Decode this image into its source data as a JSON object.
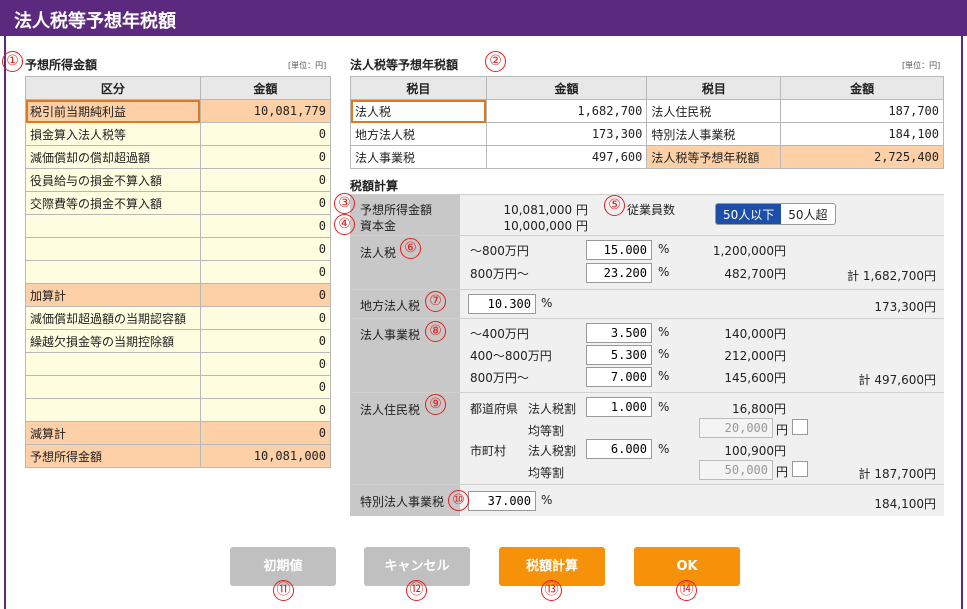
{
  "window": {
    "title": "法人税等予想年税額"
  },
  "markers": [
    "①",
    "②",
    "③",
    "④",
    "⑤",
    "⑥",
    "⑦",
    "⑧",
    "⑨",
    "⑩",
    "⑪",
    "⑫",
    "⑬",
    "⑭"
  ],
  "income": {
    "title": "予想所得金額",
    "unit": "[単位：円]",
    "headers": [
      "区分",
      "金額"
    ],
    "rows": [
      {
        "label": "税引前当期純利益",
        "value": "10,081,779"
      },
      {
        "label": "損金算入法人税等",
        "value": "0"
      },
      {
        "label": "減価償却の償却超過額",
        "value": "0"
      },
      {
        "label": "役員給与の損金不算入額",
        "value": "0"
      },
      {
        "label": "交際費等の損金不算入額",
        "value": "0"
      },
      {
        "label": "",
        "value": "0"
      },
      {
        "label": "",
        "value": "0"
      },
      {
        "label": "",
        "value": "0"
      },
      {
        "label": "加算計",
        "value": "0"
      },
      {
        "label": "減価償却超過額の当期認容額",
        "value": "0"
      },
      {
        "label": "繰越欠損金等の当期控除額",
        "value": "0"
      },
      {
        "label": "",
        "value": "0"
      },
      {
        "label": "",
        "value": "0"
      },
      {
        "label": "",
        "value": "0"
      },
      {
        "label": "減算計",
        "value": "0"
      },
      {
        "label": "予想所得金額",
        "value": "10,081,000"
      }
    ]
  },
  "annual": {
    "title": "法人税等予想年税額",
    "unit": "[単位：円]",
    "headers": [
      "税目",
      "金額",
      "税目",
      "金額"
    ],
    "rows": [
      [
        "法人税",
        "1,682,700",
        "法人住民税",
        "187,700"
      ],
      [
        "地方法人税",
        "173,300",
        "特別法人事業税",
        "184,100"
      ],
      [
        "法人事業税",
        "497,600",
        "法人税等予想年税額",
        "2,725,400"
      ]
    ]
  },
  "calc": {
    "title": "税額計算",
    "income_label": "予想所得金額",
    "income_value": "10,081,000 円",
    "capital_label": "資本金",
    "capital_value": "10,000,000 円",
    "employees_label": "従業員数",
    "employees_options": [
      "50人以下",
      "50人超"
    ],
    "percent": "%",
    "yen": "円",
    "corp_tax": {
      "label": "法人税",
      "brackets": [
        {
          "range": "～800万円",
          "rate": "15.000",
          "amount": "1,200,000円"
        },
        {
          "range": "800万円～",
          "rate": "23.200",
          "amount": "482,700円"
        }
      ],
      "total": "計 1,682,700円"
    },
    "local_corp_tax": {
      "label": "地方法人税",
      "rate": "10.300",
      "total": "173,300円"
    },
    "business_tax": {
      "label": "法人事業税",
      "brackets": [
        {
          "range": "～400万円",
          "rate": "3.500",
          "amount": "140,000円"
        },
        {
          "range": "400～800万円",
          "rate": "5.300",
          "amount": "212,000円"
        },
        {
          "range": "800万円～",
          "rate": "7.000",
          "amount": "145,600円"
        }
      ],
      "total": "計 497,600円"
    },
    "resident_tax": {
      "label": "法人住民税",
      "prefecture": "都道府県",
      "city": "市町村",
      "tax_portion": "法人税割",
      "per_capita": "均等割",
      "pref_rate": "1.000",
      "pref_amount": "16,800円",
      "pref_flat": "20,000",
      "city_rate": "6.000",
      "city_amount": "100,900円",
      "city_flat": "50,000",
      "total": "計 187,700円"
    },
    "special_tax": {
      "label": "特別法人事業税",
      "rate": "37.000",
      "total": "184,100円"
    }
  },
  "buttons": {
    "reset": "初期値",
    "cancel": "キャンセル",
    "calculate": "税額計算",
    "ok": "OK"
  },
  "colors": {
    "titlebar": "#5b2a7e",
    "highlight": "#fdd0a8",
    "input_bg": "#fffde0",
    "primary_button": "#f5920a",
    "toggle_on": "#1e4fa8"
  }
}
